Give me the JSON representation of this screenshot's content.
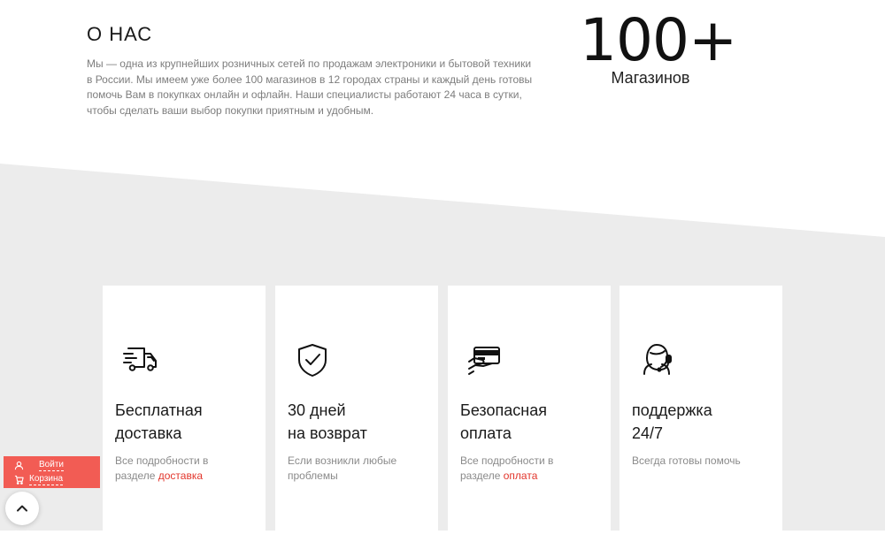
{
  "about": {
    "title": "О НАС",
    "lines": [
      "Мы — одна из крупнейших розничных сетей по продажам электроники и бытовой техники",
      "в России. Мы имеем уже более 100 магазинов в 12 городах страны и каждый день готовы",
      "помочь Вам в покупках онлайн и офлайн. Наши специалисты работают 24 часа в сутки,",
      "чтобы сделать ваши выбор покупки приятным и удобным."
    ]
  },
  "stat": {
    "value": "100+",
    "label": "Магазинов"
  },
  "features": [
    {
      "icon": "delivery-truck-icon",
      "title1": "Бесплатная",
      "title2": "доставка",
      "desc1": "Все подробности в",
      "desc2_prefix": "разделе ",
      "desc2_link": "доставка"
    },
    {
      "icon": "shield-check-icon",
      "title1": "30 дней",
      "title2": "на возврат",
      "desc1": "Если возникли любые",
      "desc2": "проблемы"
    },
    {
      "icon": "card-payment-icon",
      "title1": "Безопасная",
      "title2": "оплата",
      "desc1": "Все подробности в",
      "desc2_prefix": "разделе ",
      "desc2_link": "оплата"
    },
    {
      "icon": "support-headset-icon",
      "title1": "поддержка",
      "title2": "24/7",
      "desc1": "Всегда готовы помочь"
    }
  ],
  "side_panel": {
    "login_label": "Войти",
    "cart_label": "Корзина"
  },
  "colors": {
    "accent": "#e2352b",
    "panel": "#f25c54",
    "section_bg": "#ececec"
  }
}
